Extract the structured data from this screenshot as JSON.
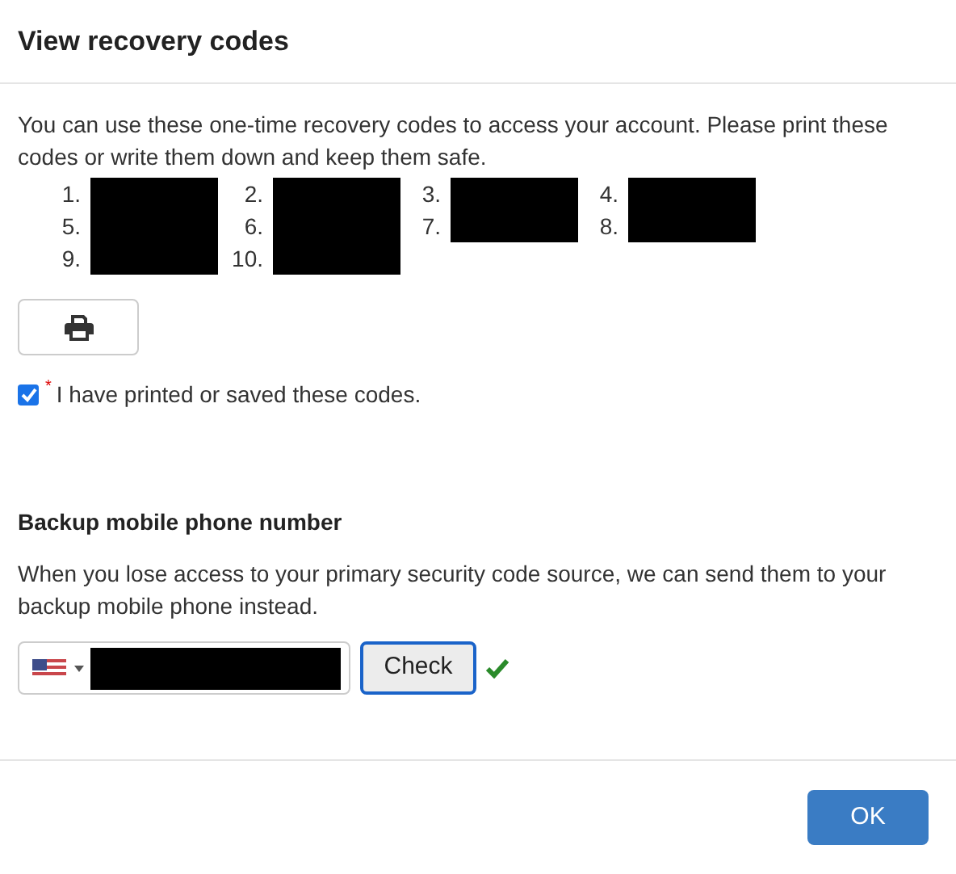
{
  "dialog": {
    "title": "View recovery codes"
  },
  "intro": "You can use these one-time recovery codes to access your account. Please print these codes or write them down and keep them safe.",
  "codes": [
    {
      "number": "1."
    },
    {
      "number": "2."
    },
    {
      "number": "3."
    },
    {
      "number": "4."
    },
    {
      "number": "5."
    },
    {
      "number": "6."
    },
    {
      "number": "7."
    },
    {
      "number": "8."
    },
    {
      "number": "9."
    },
    {
      "number": "10."
    }
  ],
  "confirm": {
    "label": "I have printed or saved these codes.",
    "required_mark": "*",
    "checked": true
  },
  "backup": {
    "heading": "Backup mobile phone number",
    "description": "When you lose access to your primary security code source, we can send them to your backup mobile phone instead.",
    "check_button": "Check",
    "verified": true
  },
  "buttons": {
    "ok": "OK"
  }
}
